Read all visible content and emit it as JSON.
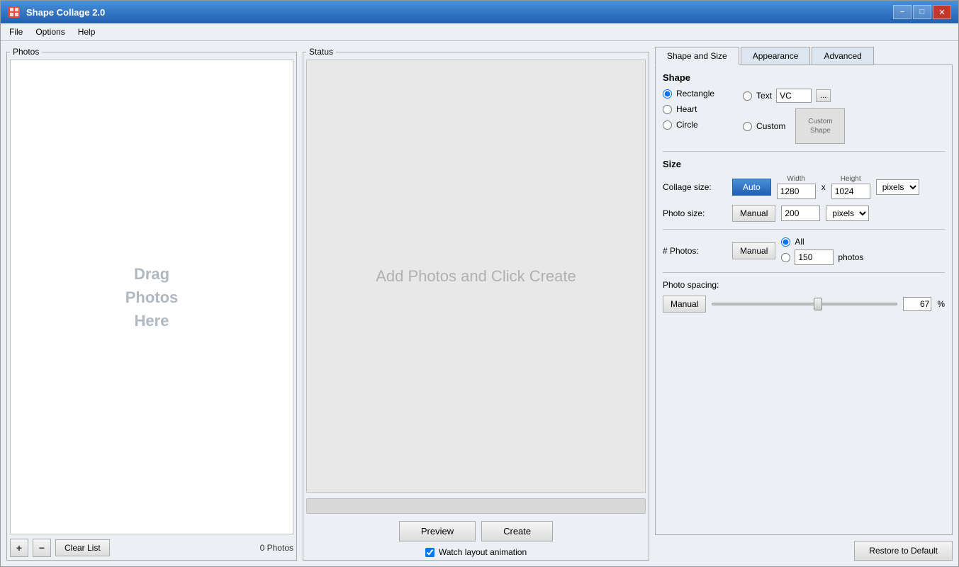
{
  "window": {
    "title": "Shape Collage 2.0",
    "minimize_label": "−",
    "restore_label": "□",
    "close_label": "✕"
  },
  "menu": {
    "file": "File",
    "options": "Options",
    "help": "Help"
  },
  "photos_panel": {
    "label": "Photos",
    "drag_text": "Drag\nPhotos\nHere",
    "drag_line1": "Drag",
    "drag_line2": "Photos",
    "drag_line3": "Here",
    "add_btn": "+",
    "remove_btn": "−",
    "clear_btn": "Clear List",
    "count": "0 Photos"
  },
  "status_panel": {
    "label": "Status",
    "placeholder": "Add Photos and Click Create",
    "preview_btn": "Preview",
    "create_btn": "Create",
    "watch_label": "Watch layout animation"
  },
  "tabs": {
    "shape_size": "Shape and Size",
    "appearance": "Appearance",
    "advanced": "Advanced"
  },
  "shape_section": {
    "title": "Shape",
    "rectangle_label": "Rectangle",
    "heart_label": "Heart",
    "circle_label": "Circle",
    "text_label": "Text",
    "text_value": "VC",
    "browse_label": "...",
    "custom_label": "Custom",
    "custom_shape_label": "Custom\nShape"
  },
  "size_section": {
    "title": "Size",
    "collage_size_label": "Collage size:",
    "auto_btn": "Auto",
    "width_label": "Width",
    "width_value": "1280",
    "x_label": "x",
    "height_label": "Height",
    "height_value": "1024",
    "pixels_option": "pixels",
    "photo_size_label": "Photo size:",
    "manual_btn_photo": "Manual",
    "photo_size_value": "200",
    "photo_pixels_option": "pixels"
  },
  "photos_num_section": {
    "label": "# Photos:",
    "manual_btn": "Manual",
    "all_label": "All",
    "count_value": "150",
    "photos_label": "photos"
  },
  "spacing_section": {
    "label": "Photo spacing:",
    "manual_btn": "Manual",
    "value": "67",
    "percent_label": "%"
  },
  "footer": {
    "restore_btn": "Restore to Default"
  }
}
